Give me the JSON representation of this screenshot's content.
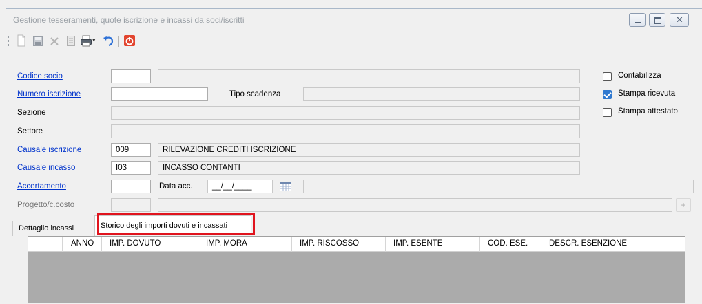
{
  "window": {
    "title": "Gestione tesseramenti, quote iscrizione e incassi da soci/iscritti",
    "minimize_symbol": "‒",
    "maximize_symbol": "□",
    "close_symbol": "✕"
  },
  "toolbar": {
    "buttons": [
      {
        "icon": "new-document-icon"
      },
      {
        "icon": "save-icon"
      },
      {
        "icon": "delete-icon"
      },
      {
        "icon": "notes-icon"
      },
      {
        "icon": "print-icon"
      },
      {
        "icon": "undo-icon"
      },
      {
        "icon": "exit-icon"
      }
    ],
    "print_dropdown": "▾"
  },
  "form": {
    "codice_socio": {
      "label": "Codice socio",
      "value": "",
      "desc": ""
    },
    "numero_iscrizione": {
      "label": "Numero iscrizione",
      "value": ""
    },
    "tipo_scadenza": {
      "label": "Tipo scadenza",
      "value": ""
    },
    "sezione": {
      "label": "Sezione",
      "value": ""
    },
    "settore": {
      "label": "Settore",
      "value": ""
    },
    "causale_iscrizione": {
      "label": "Causale iscrizione",
      "code": "009",
      "desc": "RILEVAZIONE CREDITI ISCRIZIONE"
    },
    "causale_incasso": {
      "label": "Causale incasso",
      "code": "I03",
      "desc": "INCASSO CONTANTI"
    },
    "accertamento": {
      "label": "Accertamento",
      "value": "",
      "desc": ""
    },
    "data_acc": {
      "label": "Data acc.",
      "value": "__/__/____"
    },
    "progetto": {
      "label": "Progetto/c.costo",
      "value": ""
    },
    "plus_button": "+"
  },
  "options": {
    "contabilizza": {
      "label": "Contabilizza",
      "checked": false
    },
    "stampa_ricevuta": {
      "label": "Stampa ricevuta",
      "checked": true
    },
    "stampa_attestato": {
      "label": "Stampa attestato",
      "checked": false
    }
  },
  "tabs": [
    {
      "label": "Dettaglio incassi"
    },
    {
      "label": "Storico degli importi dovuti e incassati"
    }
  ],
  "grid": {
    "columns": [
      "ANNO",
      "IMP. DOVUTO",
      "IMP. MORA",
      "IMP. RISCOSSO",
      "IMP. ESENTE",
      "COD. ESE.",
      "DESCR. ESENZIONE"
    ]
  },
  "colors": {
    "link": "#0033cc",
    "highlight": "#e0141e",
    "check": "#3079d0"
  }
}
